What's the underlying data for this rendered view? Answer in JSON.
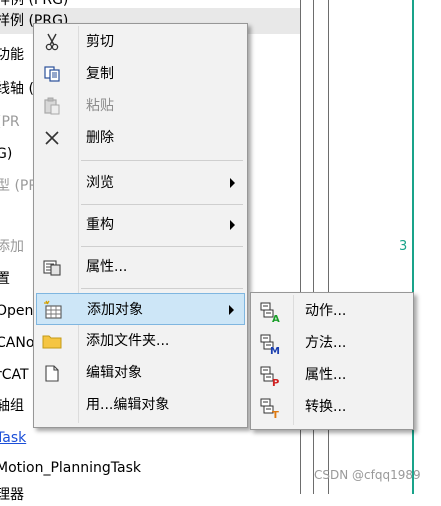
{
  "tree": {
    "lines": [
      {
        "text": "样例 (PRG)",
        "style": "normal"
      },
      {
        "text": "功能",
        "style": "normal"
      },
      {
        "text": "线轴 (F",
        "style": "normal"
      },
      {
        "text": "(PR",
        "style": "gray"
      },
      {
        "text": "G)",
        "style": "normal"
      },
      {
        "text": "型 (PR",
        "style": "gray"
      },
      {
        "text": "",
        "style": "normal"
      },
      {
        "text": "添加",
        "style": "gray"
      },
      {
        "text": "置",
        "style": "normal"
      },
      {
        "text": "Open",
        "style": "normal"
      },
      {
        "text": "CANo",
        "style": "normal"
      },
      {
        "text": "rCAT",
        "style": "normal"
      },
      {
        "text": "轴组",
        "style": "normal"
      },
      {
        "text": "Task",
        "style": "link"
      },
      {
        "text": "Motion_PlanningTask",
        "style": "normal"
      },
      {
        "text": "理器",
        "style": "normal"
      }
    ],
    "chart_number": "3",
    "watermark": "CSDN @cfqq1989"
  },
  "context_menu": {
    "items": [
      {
        "label": "剪切",
        "icon": "scissors-icon",
        "disabled": false
      },
      {
        "label": "复制",
        "icon": "copy-icon",
        "disabled": false
      },
      {
        "label": "粘贴",
        "icon": "paste-icon",
        "disabled": true
      },
      {
        "label": "删除",
        "icon": "delete-x-icon",
        "disabled": false
      },
      {
        "label": "浏览",
        "icon": "",
        "submenu": true
      },
      {
        "label": "重构",
        "icon": "",
        "submenu": true
      },
      {
        "label": "属性...",
        "icon": "properties-icon"
      },
      {
        "label": "添加对象",
        "icon": "add-object-icon",
        "submenu": true,
        "active": true
      },
      {
        "label": "添加文件夹...",
        "icon": "folder-icon"
      },
      {
        "label": "编辑对象",
        "icon": "edit-object-icon"
      },
      {
        "label": "用...编辑对象",
        "icon": ""
      }
    ]
  },
  "submenu": {
    "items": [
      {
        "label": "动作...",
        "icon": "action-icon",
        "badge": "A",
        "badge_color": "#1a9e2a"
      },
      {
        "label": "方法...",
        "icon": "method-icon",
        "badge": "M",
        "badge_color": "#1b3fb0"
      },
      {
        "label": "属性...",
        "icon": "property-icon",
        "badge": "P",
        "badge_color": "#d02020"
      },
      {
        "label": "转换...",
        "icon": "transition-icon",
        "badge": "T",
        "badge_color": "#e07a10"
      }
    ]
  },
  "colors": {
    "menu_bg": "#f2f2f2",
    "active_bg": "#cde6f7",
    "accent_line": "#19a38a"
  }
}
